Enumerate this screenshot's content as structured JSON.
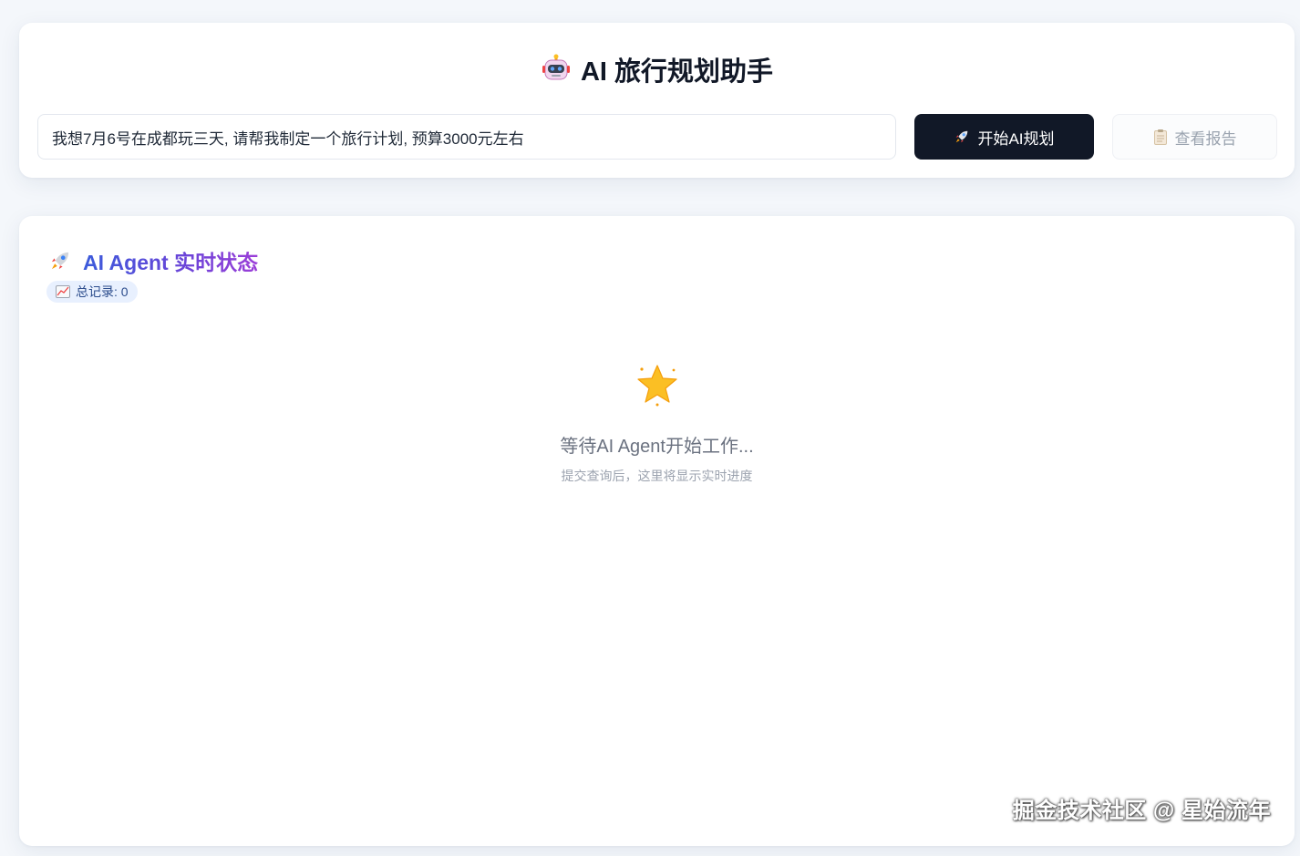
{
  "header": {
    "title": "AI 旅行规划助手",
    "icon": "robot-icon"
  },
  "query": {
    "value": "我想7月6号在成都玩三天, 请帮我制定一个旅行计划, 预算3000元左右",
    "placeholder": ""
  },
  "actions": {
    "start_label": "开始AI规划",
    "start_icon": "rocket-icon",
    "report_label": "查看报告",
    "report_icon": "clipboard-icon"
  },
  "status_panel": {
    "title": "AI Agent 实时状态",
    "title_icon": "rocket-icon",
    "record_badge": "总记录: 0",
    "record_icon": "chart-icon",
    "empty_icon": "star-icon",
    "empty_title": "等待AI Agent开始工作...",
    "empty_subtitle": "提交查询后，这里将显示实时进度"
  },
  "watermark": "掘金技术社区 @ 星始流年",
  "colors": {
    "primary_button": "#111827",
    "title_gradient_start": "#3b5bdb",
    "title_gradient_end": "#9b3ed8",
    "badge_bg": "#e8f0fe",
    "page_bg": "#f4f7fb"
  }
}
